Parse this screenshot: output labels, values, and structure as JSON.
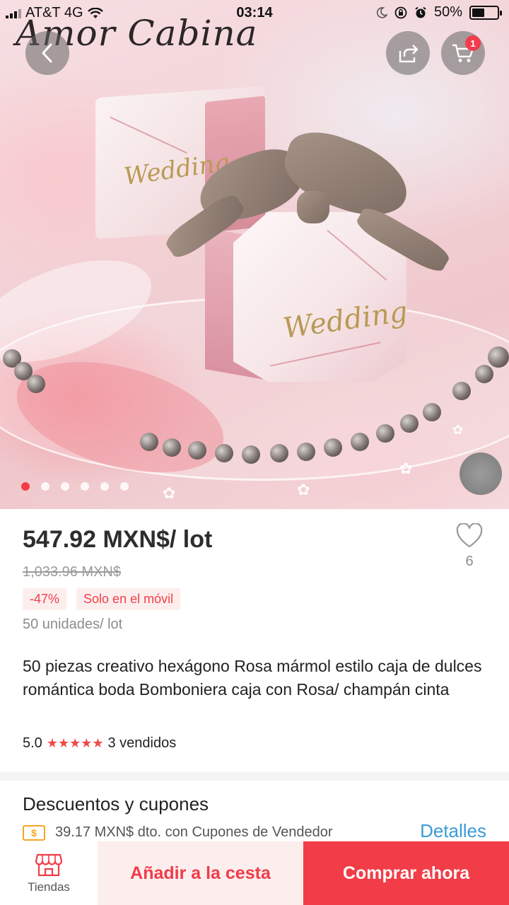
{
  "status_bar": {
    "carrier": "AT&T 4G",
    "time": "03:14",
    "battery": "50%"
  },
  "hero": {
    "brand": "Amor Cabina",
    "box_text": "Wedding",
    "cart_badge": "1",
    "image_count": 6,
    "active_image": 1,
    "icons": {
      "back": "chevron-left-icon",
      "share": "share-icon",
      "cart": "shopping-cart-icon"
    }
  },
  "product": {
    "price": "547.92 MXN$/ lot",
    "original_price": "1,033.96 MXN$",
    "discount_tag": "-47%",
    "mobile_tag": "Solo en el móvil",
    "units": "50 unidades/ lot",
    "wishlist_count": "6",
    "title": "50 piezas creativo hexágono Rosa mármol estilo caja de dulces romántica boda Bomboniera caja con Rosa/ champán cinta",
    "rating": "5.0",
    "stars": "★★★★★",
    "sold": "3 vendidos"
  },
  "coupons": {
    "heading": "Descuentos y cupones",
    "coupon_icon_label": "$",
    "coupon_text": "39.17 MXN$ dto. con Cupones de Vendedor",
    "details_link": "Detalles"
  },
  "bottom_bar": {
    "store_label": "Tiendas",
    "add_to_cart": "Añadir a la cesta",
    "buy_now": "Comprar ahora"
  },
  "colors": {
    "accent": "#f23d48",
    "accent_light": "#fdeeee",
    "link": "#3b9bd6"
  }
}
